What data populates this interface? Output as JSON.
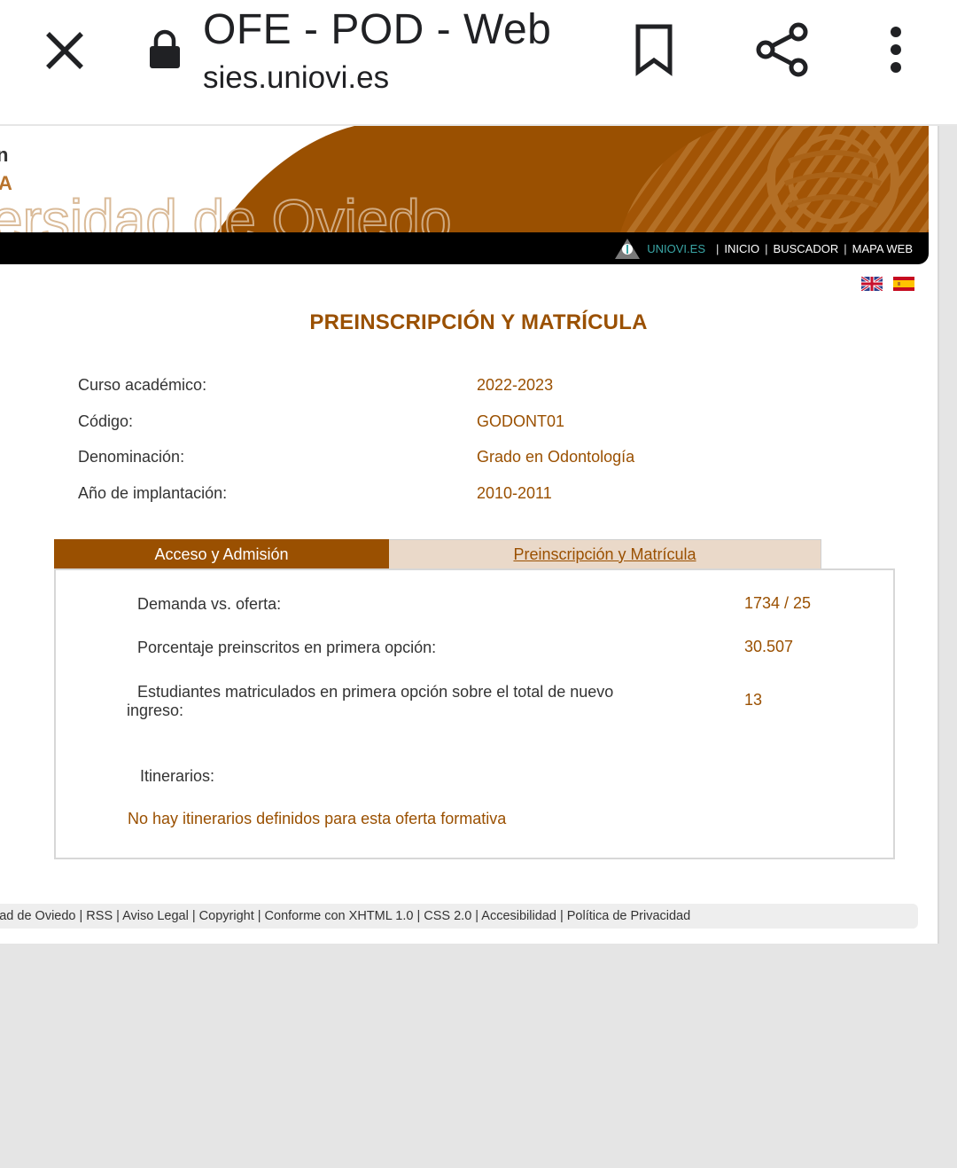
{
  "chrome": {
    "title": "OFE - POD - Web",
    "url": "sies.uniovi.es",
    "icons": [
      "close-icon",
      "lock-icon",
      "bookmark-icon",
      "share-icon",
      "more-icon"
    ]
  },
  "banner": {
    "left_letters_1": "n",
    "left_letters_2": "A",
    "watermark": "ersidad de Oviedo",
    "colors": {
      "brand": "#9a5001"
    }
  },
  "navbar": {
    "uniovi": "UNIOVI.ES",
    "sep": "|",
    "links": [
      "INICIO",
      "BUSCADOR",
      "MAPA WEB"
    ]
  },
  "heading": "PREINSCRIPCIÓN Y MATRÍCULA",
  "info": [
    {
      "label": "Curso académico:",
      "value": "2022-2023"
    },
    {
      "label": "Código:",
      "value": "GODONT01"
    },
    {
      "label": "Denominación:",
      "value": "Grado en Odontología"
    },
    {
      "label": "Año de implantación:",
      "value": "2010-2011"
    }
  ],
  "tabs": {
    "active": "Acceso y Admisión",
    "inactive": "Preinscripción y Matrícula"
  },
  "panel": {
    "demanda": {
      "label": "Demanda vs. oferta:",
      "value": "1734 / 25"
    },
    "porcentaje": {
      "label": "Porcentaje preinscritos en primera opción:",
      "value": "30.507"
    },
    "estudiantes": {
      "label_line1": "Estudiantes matriculados en primera opción sobre el total de nuevo",
      "label_line2": "ingreso:",
      "value": "13"
    },
    "itinerarios_label": "Itinerarios:",
    "no_itinerarios": "No hay itinerarios definidos para esta oferta formativa"
  },
  "footer": "lad de Oviedo | RSS | Aviso Legal | Copyright | Conforme con XHTML 1.0 | CSS 2.0 | Accesibilidad | Política de Privacidad"
}
